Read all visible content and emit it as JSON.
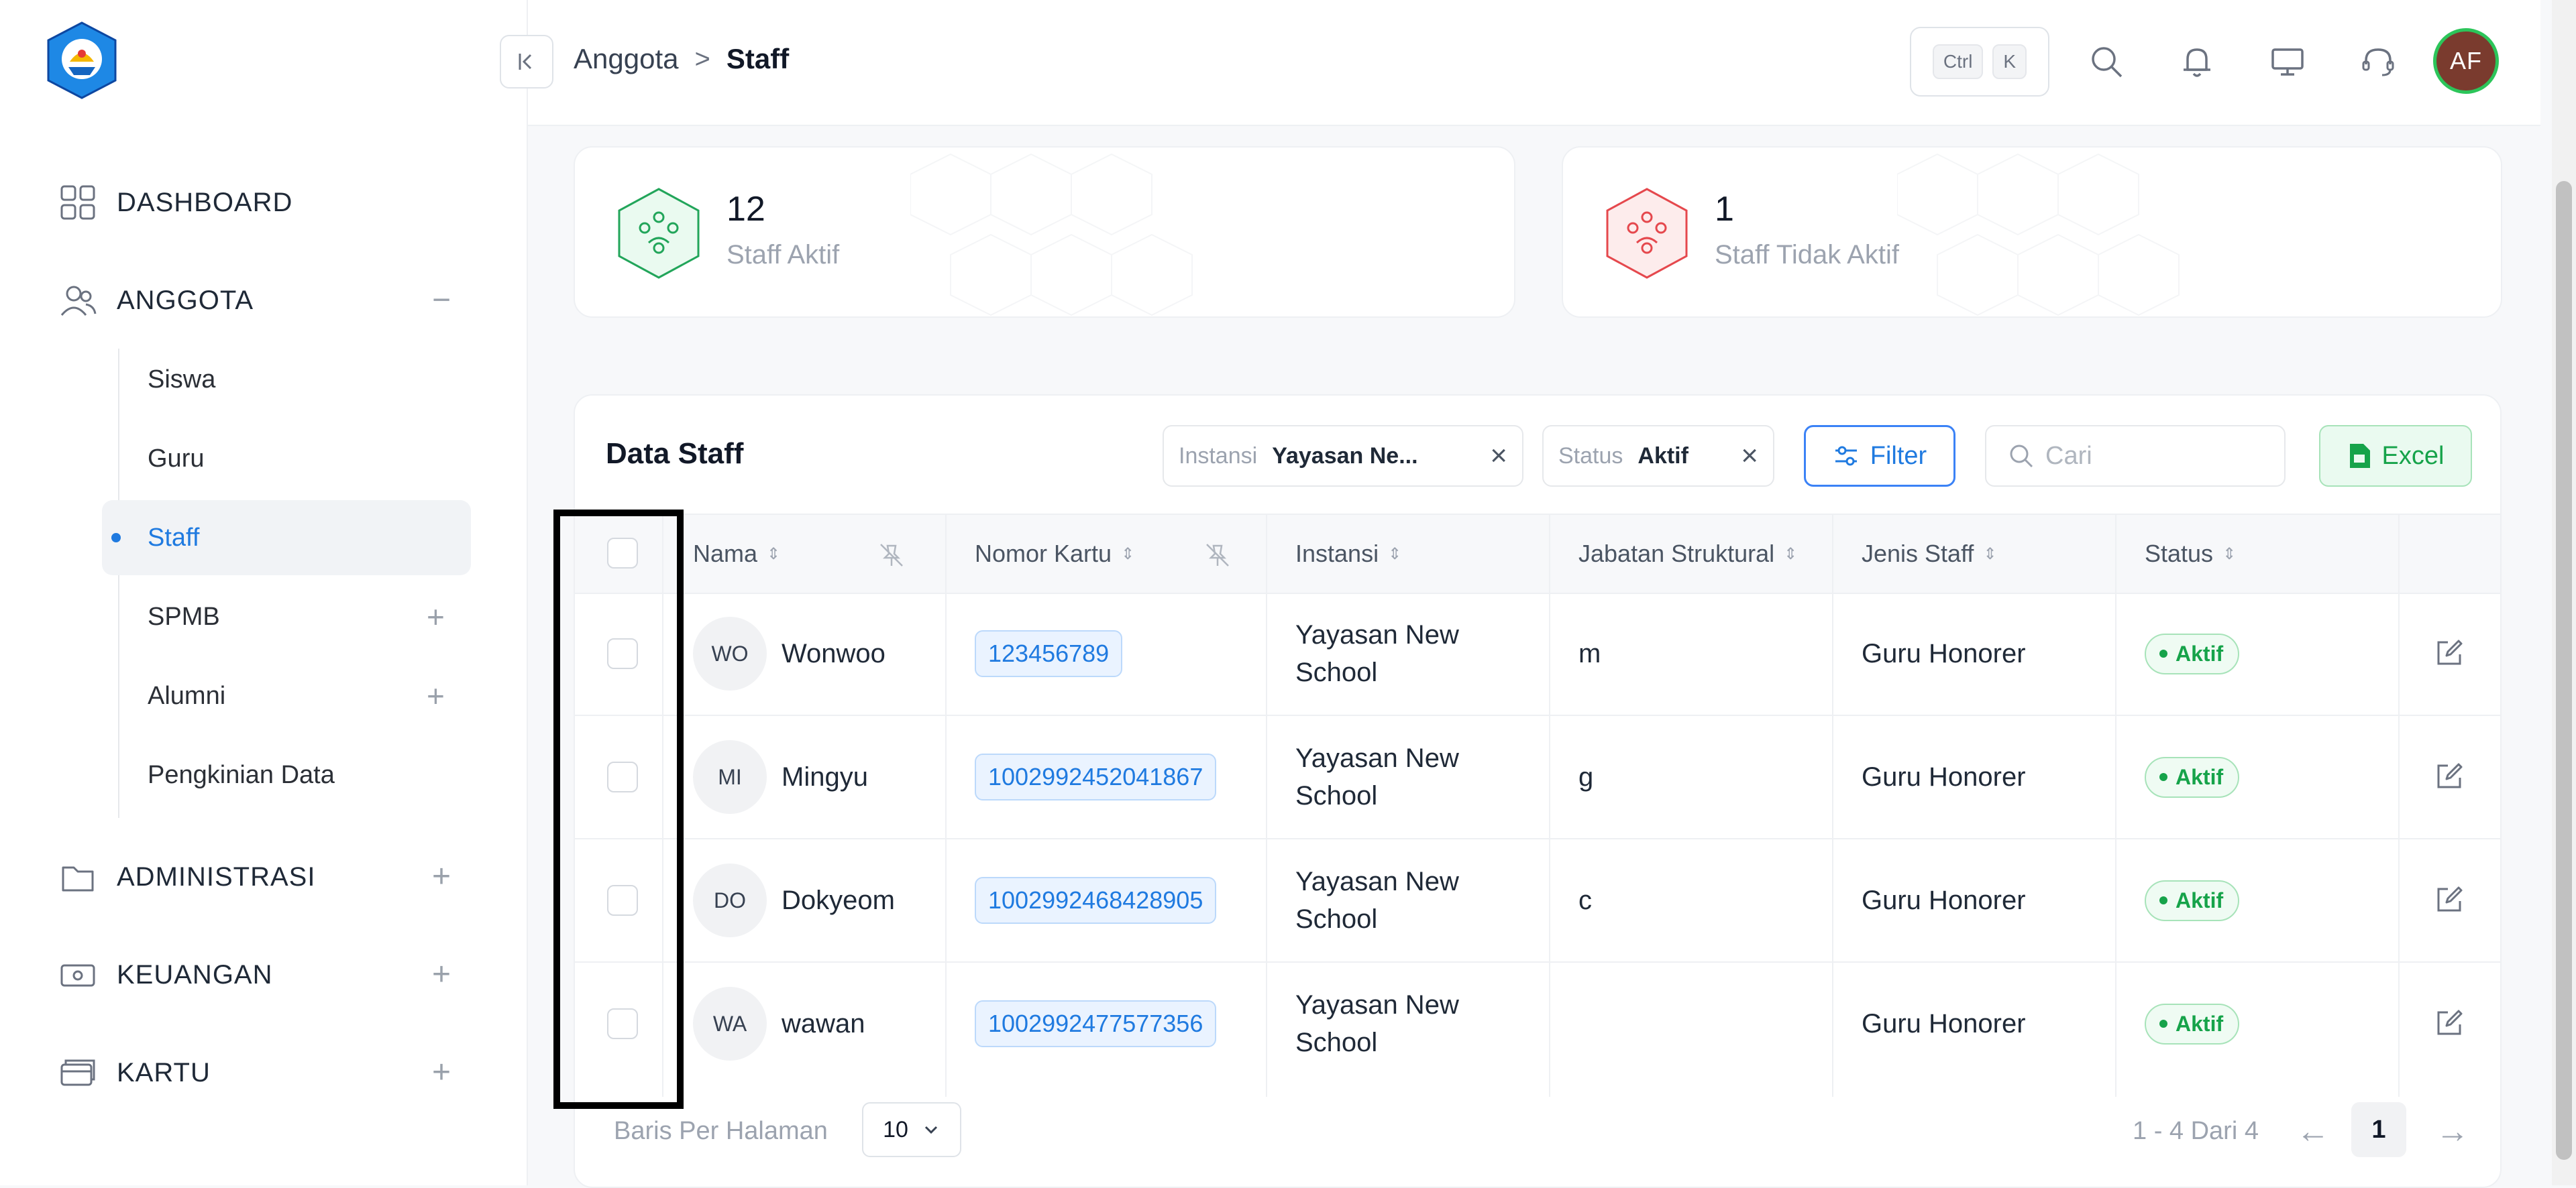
{
  "sidebar": {
    "groups": [
      {
        "label": "DASHBOARD",
        "icon": "grid-icon"
      },
      {
        "label": "ANGGOTA",
        "icon": "users-icon",
        "toggle": "−"
      },
      {
        "label": "ADMINISTRASI",
        "icon": "folder-icon",
        "toggle": "+"
      },
      {
        "label": "KEUANGAN",
        "icon": "money-icon",
        "toggle": "+"
      },
      {
        "label": "KARTU",
        "icon": "card-icon",
        "toggle": "+"
      }
    ],
    "anggota_items": [
      {
        "label": "Siswa"
      },
      {
        "label": "Guru"
      },
      {
        "label": "Staff",
        "active": true
      },
      {
        "label": "SPMB",
        "toggle": "+"
      },
      {
        "label": "Alumni",
        "toggle": "+"
      },
      {
        "label": "Pengkinian Data"
      }
    ]
  },
  "header": {
    "breadcrumb_parent": "Anggota",
    "breadcrumb_sep": ">",
    "breadcrumb_current": "Staff",
    "shortcut_ctrl": "Ctrl",
    "shortcut_key": "K",
    "avatar_initials": "AF"
  },
  "stats": {
    "active": {
      "value": "12",
      "label": "Staff Aktif",
      "color": "#22a55a"
    },
    "inactive": {
      "value": "1",
      "label": "Staff Tidak Aktif",
      "color": "#e5484d"
    }
  },
  "table": {
    "title": "Data Staff",
    "filters": [
      {
        "key": "Instansi",
        "value": "Yayasan Ne..."
      },
      {
        "key": "Status",
        "value": "Aktif"
      }
    ],
    "filter_label": "Filter",
    "search_placeholder": "Cari",
    "excel_label": "Excel",
    "columns": [
      "Nama",
      "Nomor Kartu",
      "Instansi",
      "Jabatan Struktural",
      "Jenis Staff",
      "Status"
    ],
    "rows": [
      {
        "initials": "WO",
        "name": "Wonwoo",
        "card": "123456789",
        "inst1": "Yayasan New",
        "inst2": "School",
        "jabatan": "m",
        "jenis": "Guru Honorer",
        "status": "Aktif"
      },
      {
        "initials": "MI",
        "name": "Mingyu",
        "card": "1002992452041867",
        "inst1": "Yayasan New",
        "inst2": "School",
        "jabatan": "g",
        "jenis": "Guru Honorer",
        "status": "Aktif"
      },
      {
        "initials": "DO",
        "name": "Dokyeom",
        "card": "1002992468428905",
        "inst1": "Yayasan New",
        "inst2": "School",
        "jabatan": "c",
        "jenis": "Guru Honorer",
        "status": "Aktif"
      },
      {
        "initials": "WA",
        "name": "wawan",
        "card": "1002992477577356",
        "inst1": "Yayasan New",
        "inst2": "School",
        "jabatan": "",
        "jenis": "Guru Honorer",
        "status": "Aktif"
      }
    ],
    "rows_per_page_label": "Baris Per Halaman",
    "rows_per_page": "10",
    "page_info": "1 - 4 Dari 4",
    "current_page": "1",
    "prev_arrow": "←",
    "next_arrow": "→"
  }
}
